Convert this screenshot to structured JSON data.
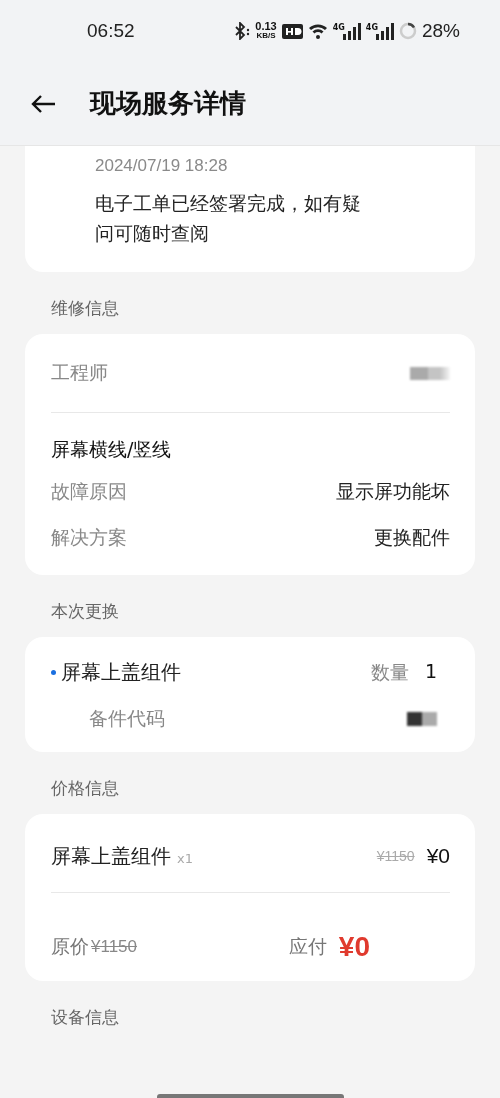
{
  "status_bar": {
    "time": "06:52",
    "speed": "0.13",
    "speed_unit": "KB/S",
    "networks": [
      "4G",
      "4G"
    ],
    "battery": "28%"
  },
  "header": {
    "title": "现场服务详情"
  },
  "status_card": {
    "time": "2024/07/19 18:28",
    "message": "电子工单已经签署完成，如有疑问可随时查阅"
  },
  "repair": {
    "title": "维修信息",
    "engineer_label": "工程师",
    "fault": "屏幕横线/竖线",
    "rows": [
      {
        "label": "故障原因",
        "value": "显示屏功能坏"
      },
      {
        "label": "解决方案",
        "value": "更换配件"
      }
    ]
  },
  "replacement": {
    "title": "本次更换",
    "parts": [
      {
        "name": "屏幕上盖组件",
        "qty_label": "数量",
        "qty": "1",
        "code_label": "备件代码"
      }
    ]
  },
  "price": {
    "title": "价格信息",
    "items": [
      {
        "name": "屏幕上盖组件",
        "count": "x1",
        "original": "¥1150",
        "price": "¥0"
      }
    ],
    "original_label": "原价",
    "original_total": "¥1150",
    "due_label": "应付",
    "due": "¥0"
  },
  "device": {
    "title": "设备信息"
  }
}
